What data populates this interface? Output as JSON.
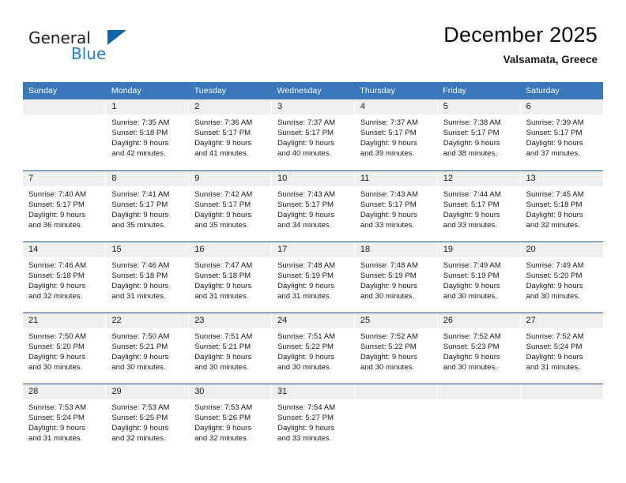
{
  "brand": {
    "name_part1": "General",
    "name_part2": "Blue",
    "triangle_icon": "brand-triangle-icon",
    "accent_dark": "#1464aa",
    "accent_light": "#1d7fd4"
  },
  "header": {
    "title": "December 2025",
    "subtitle": "Valsamata, Greece"
  },
  "theme": {
    "header_blue": "#3a77bb",
    "grid_line": "#1a5596",
    "daynum_band": "#efefef"
  },
  "weekday_headers": [
    "Sunday",
    "Monday",
    "Tuesday",
    "Wednesday",
    "Thursday",
    "Friday",
    "Saturday"
  ],
  "weeks": [
    [
      {
        "day": "",
        "lines": [
          "",
          "",
          "",
          ""
        ],
        "empty": true
      },
      {
        "day": "1",
        "lines": [
          "Sunrise: 7:35 AM",
          "Sunset: 5:18 PM",
          "Daylight: 9 hours",
          "and 42 minutes."
        ]
      },
      {
        "day": "2",
        "lines": [
          "Sunrise: 7:36 AM",
          "Sunset: 5:17 PM",
          "Daylight: 9 hours",
          "and 41 minutes."
        ]
      },
      {
        "day": "3",
        "lines": [
          "Sunrise: 7:37 AM",
          "Sunset: 5:17 PM",
          "Daylight: 9 hours",
          "and 40 minutes."
        ]
      },
      {
        "day": "4",
        "lines": [
          "Sunrise: 7:37 AM",
          "Sunset: 5:17 PM",
          "Daylight: 9 hours",
          "and 39 minutes."
        ]
      },
      {
        "day": "5",
        "lines": [
          "Sunrise: 7:38 AM",
          "Sunset: 5:17 PM",
          "Daylight: 9 hours",
          "and 38 minutes."
        ]
      },
      {
        "day": "6",
        "lines": [
          "Sunrise: 7:39 AM",
          "Sunset: 5:17 PM",
          "Daylight: 9 hours",
          "and 37 minutes."
        ]
      }
    ],
    [
      {
        "day": "7",
        "lines": [
          "Sunrise: 7:40 AM",
          "Sunset: 5:17 PM",
          "Daylight: 9 hours",
          "and 36 minutes."
        ]
      },
      {
        "day": "8",
        "lines": [
          "Sunrise: 7:41 AM",
          "Sunset: 5:17 PM",
          "Daylight: 9 hours",
          "and 35 minutes."
        ]
      },
      {
        "day": "9",
        "lines": [
          "Sunrise: 7:42 AM",
          "Sunset: 5:17 PM",
          "Daylight: 9 hours",
          "and 35 minutes."
        ]
      },
      {
        "day": "10",
        "lines": [
          "Sunrise: 7:43 AM",
          "Sunset: 5:17 PM",
          "Daylight: 9 hours",
          "and 34 minutes."
        ]
      },
      {
        "day": "11",
        "lines": [
          "Sunrise: 7:43 AM",
          "Sunset: 5:17 PM",
          "Daylight: 9 hours",
          "and 33 minutes."
        ]
      },
      {
        "day": "12",
        "lines": [
          "Sunrise: 7:44 AM",
          "Sunset: 5:17 PM",
          "Daylight: 9 hours",
          "and 33 minutes."
        ]
      },
      {
        "day": "13",
        "lines": [
          "Sunrise: 7:45 AM",
          "Sunset: 5:18 PM",
          "Daylight: 9 hours",
          "and 32 minutes."
        ]
      }
    ],
    [
      {
        "day": "14",
        "lines": [
          "Sunrise: 7:46 AM",
          "Sunset: 5:18 PM",
          "Daylight: 9 hours",
          "and 32 minutes."
        ]
      },
      {
        "day": "15",
        "lines": [
          "Sunrise: 7:46 AM",
          "Sunset: 5:18 PM",
          "Daylight: 9 hours",
          "and 31 minutes."
        ]
      },
      {
        "day": "16",
        "lines": [
          "Sunrise: 7:47 AM",
          "Sunset: 5:18 PM",
          "Daylight: 9 hours",
          "and 31 minutes."
        ]
      },
      {
        "day": "17",
        "lines": [
          "Sunrise: 7:48 AM",
          "Sunset: 5:19 PM",
          "Daylight: 9 hours",
          "and 31 minutes."
        ]
      },
      {
        "day": "18",
        "lines": [
          "Sunrise: 7:48 AM",
          "Sunset: 5:19 PM",
          "Daylight: 9 hours",
          "and 30 minutes."
        ]
      },
      {
        "day": "19",
        "lines": [
          "Sunrise: 7:49 AM",
          "Sunset: 5:19 PM",
          "Daylight: 9 hours",
          "and 30 minutes."
        ]
      },
      {
        "day": "20",
        "lines": [
          "Sunrise: 7:49 AM",
          "Sunset: 5:20 PM",
          "Daylight: 9 hours",
          "and 30 minutes."
        ]
      }
    ],
    [
      {
        "day": "21",
        "lines": [
          "Sunrise: 7:50 AM",
          "Sunset: 5:20 PM",
          "Daylight: 9 hours",
          "and 30 minutes."
        ]
      },
      {
        "day": "22",
        "lines": [
          "Sunrise: 7:50 AM",
          "Sunset: 5:21 PM",
          "Daylight: 9 hours",
          "and 30 minutes."
        ]
      },
      {
        "day": "23",
        "lines": [
          "Sunrise: 7:51 AM",
          "Sunset: 5:21 PM",
          "Daylight: 9 hours",
          "and 30 minutes."
        ]
      },
      {
        "day": "24",
        "lines": [
          "Sunrise: 7:51 AM",
          "Sunset: 5:22 PM",
          "Daylight: 9 hours",
          "and 30 minutes."
        ]
      },
      {
        "day": "25",
        "lines": [
          "Sunrise: 7:52 AM",
          "Sunset: 5:22 PM",
          "Daylight: 9 hours",
          "and 30 minutes."
        ]
      },
      {
        "day": "26",
        "lines": [
          "Sunrise: 7:52 AM",
          "Sunset: 5:23 PM",
          "Daylight: 9 hours",
          "and 30 minutes."
        ]
      },
      {
        "day": "27",
        "lines": [
          "Sunrise: 7:52 AM",
          "Sunset: 5:24 PM",
          "Daylight: 9 hours",
          "and 31 minutes."
        ]
      }
    ],
    [
      {
        "day": "28",
        "lines": [
          "Sunrise: 7:53 AM",
          "Sunset: 5:24 PM",
          "Daylight: 9 hours",
          "and 31 minutes."
        ]
      },
      {
        "day": "29",
        "lines": [
          "Sunrise: 7:53 AM",
          "Sunset: 5:25 PM",
          "Daylight: 9 hours",
          "and 32 minutes."
        ]
      },
      {
        "day": "30",
        "lines": [
          "Sunrise: 7:53 AM",
          "Sunset: 5:26 PM",
          "Daylight: 9 hours",
          "and 32 minutes."
        ]
      },
      {
        "day": "31",
        "lines": [
          "Sunrise: 7:54 AM",
          "Sunset: 5:27 PM",
          "Daylight: 9 hours",
          "and 33 minutes."
        ]
      },
      {
        "day": "",
        "lines": [
          "",
          "",
          "",
          ""
        ],
        "empty": true
      },
      {
        "day": "",
        "lines": [
          "",
          "",
          "",
          ""
        ],
        "empty": true
      },
      {
        "day": "",
        "lines": [
          "",
          "",
          "",
          ""
        ],
        "empty": true
      }
    ]
  ]
}
